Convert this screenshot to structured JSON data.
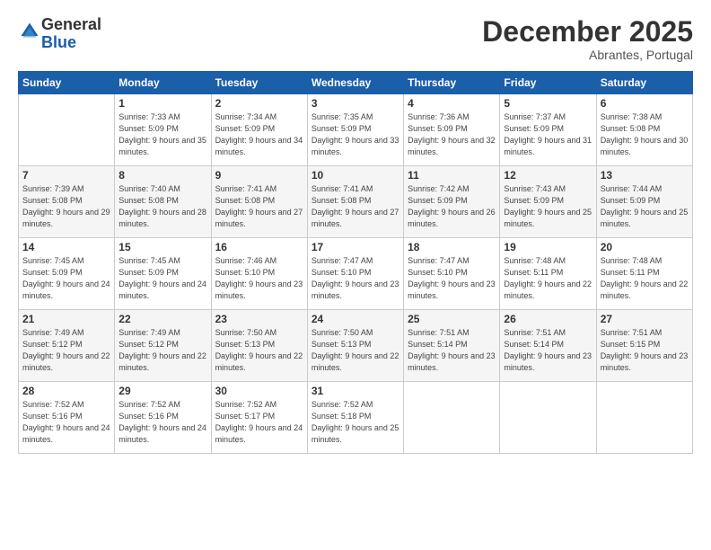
{
  "logo": {
    "general": "General",
    "blue": "Blue"
  },
  "header": {
    "month": "December 2025",
    "location": "Abrantes, Portugal"
  },
  "weekdays": [
    "Sunday",
    "Monday",
    "Tuesday",
    "Wednesday",
    "Thursday",
    "Friday",
    "Saturday"
  ],
  "weeks": [
    [
      {
        "day": "",
        "sunrise": "",
        "sunset": "",
        "daylight": ""
      },
      {
        "day": "1",
        "sunrise": "Sunrise: 7:33 AM",
        "sunset": "Sunset: 5:09 PM",
        "daylight": "Daylight: 9 hours and 35 minutes."
      },
      {
        "day": "2",
        "sunrise": "Sunrise: 7:34 AM",
        "sunset": "Sunset: 5:09 PM",
        "daylight": "Daylight: 9 hours and 34 minutes."
      },
      {
        "day": "3",
        "sunrise": "Sunrise: 7:35 AM",
        "sunset": "Sunset: 5:09 PM",
        "daylight": "Daylight: 9 hours and 33 minutes."
      },
      {
        "day": "4",
        "sunrise": "Sunrise: 7:36 AM",
        "sunset": "Sunset: 5:09 PM",
        "daylight": "Daylight: 9 hours and 32 minutes."
      },
      {
        "day": "5",
        "sunrise": "Sunrise: 7:37 AM",
        "sunset": "Sunset: 5:09 PM",
        "daylight": "Daylight: 9 hours and 31 minutes."
      },
      {
        "day": "6",
        "sunrise": "Sunrise: 7:38 AM",
        "sunset": "Sunset: 5:08 PM",
        "daylight": "Daylight: 9 hours and 30 minutes."
      }
    ],
    [
      {
        "day": "7",
        "sunrise": "Sunrise: 7:39 AM",
        "sunset": "Sunset: 5:08 PM",
        "daylight": "Daylight: 9 hours and 29 minutes."
      },
      {
        "day": "8",
        "sunrise": "Sunrise: 7:40 AM",
        "sunset": "Sunset: 5:08 PM",
        "daylight": "Daylight: 9 hours and 28 minutes."
      },
      {
        "day": "9",
        "sunrise": "Sunrise: 7:41 AM",
        "sunset": "Sunset: 5:08 PM",
        "daylight": "Daylight: 9 hours and 27 minutes."
      },
      {
        "day": "10",
        "sunrise": "Sunrise: 7:41 AM",
        "sunset": "Sunset: 5:08 PM",
        "daylight": "Daylight: 9 hours and 27 minutes."
      },
      {
        "day": "11",
        "sunrise": "Sunrise: 7:42 AM",
        "sunset": "Sunset: 5:09 PM",
        "daylight": "Daylight: 9 hours and 26 minutes."
      },
      {
        "day": "12",
        "sunrise": "Sunrise: 7:43 AM",
        "sunset": "Sunset: 5:09 PM",
        "daylight": "Daylight: 9 hours and 25 minutes."
      },
      {
        "day": "13",
        "sunrise": "Sunrise: 7:44 AM",
        "sunset": "Sunset: 5:09 PM",
        "daylight": "Daylight: 9 hours and 25 minutes."
      }
    ],
    [
      {
        "day": "14",
        "sunrise": "Sunrise: 7:45 AM",
        "sunset": "Sunset: 5:09 PM",
        "daylight": "Daylight: 9 hours and 24 minutes."
      },
      {
        "day": "15",
        "sunrise": "Sunrise: 7:45 AM",
        "sunset": "Sunset: 5:09 PM",
        "daylight": "Daylight: 9 hours and 24 minutes."
      },
      {
        "day": "16",
        "sunrise": "Sunrise: 7:46 AM",
        "sunset": "Sunset: 5:10 PM",
        "daylight": "Daylight: 9 hours and 23 minutes."
      },
      {
        "day": "17",
        "sunrise": "Sunrise: 7:47 AM",
        "sunset": "Sunset: 5:10 PM",
        "daylight": "Daylight: 9 hours and 23 minutes."
      },
      {
        "day": "18",
        "sunrise": "Sunrise: 7:47 AM",
        "sunset": "Sunset: 5:10 PM",
        "daylight": "Daylight: 9 hours and 23 minutes."
      },
      {
        "day": "19",
        "sunrise": "Sunrise: 7:48 AM",
        "sunset": "Sunset: 5:11 PM",
        "daylight": "Daylight: 9 hours and 22 minutes."
      },
      {
        "day": "20",
        "sunrise": "Sunrise: 7:48 AM",
        "sunset": "Sunset: 5:11 PM",
        "daylight": "Daylight: 9 hours and 22 minutes."
      }
    ],
    [
      {
        "day": "21",
        "sunrise": "Sunrise: 7:49 AM",
        "sunset": "Sunset: 5:12 PM",
        "daylight": "Daylight: 9 hours and 22 minutes."
      },
      {
        "day": "22",
        "sunrise": "Sunrise: 7:49 AM",
        "sunset": "Sunset: 5:12 PM",
        "daylight": "Daylight: 9 hours and 22 minutes."
      },
      {
        "day": "23",
        "sunrise": "Sunrise: 7:50 AM",
        "sunset": "Sunset: 5:13 PM",
        "daylight": "Daylight: 9 hours and 22 minutes."
      },
      {
        "day": "24",
        "sunrise": "Sunrise: 7:50 AM",
        "sunset": "Sunset: 5:13 PM",
        "daylight": "Daylight: 9 hours and 22 minutes."
      },
      {
        "day": "25",
        "sunrise": "Sunrise: 7:51 AM",
        "sunset": "Sunset: 5:14 PM",
        "daylight": "Daylight: 9 hours and 23 minutes."
      },
      {
        "day": "26",
        "sunrise": "Sunrise: 7:51 AM",
        "sunset": "Sunset: 5:14 PM",
        "daylight": "Daylight: 9 hours and 23 minutes."
      },
      {
        "day": "27",
        "sunrise": "Sunrise: 7:51 AM",
        "sunset": "Sunset: 5:15 PM",
        "daylight": "Daylight: 9 hours and 23 minutes."
      }
    ],
    [
      {
        "day": "28",
        "sunrise": "Sunrise: 7:52 AM",
        "sunset": "Sunset: 5:16 PM",
        "daylight": "Daylight: 9 hours and 24 minutes."
      },
      {
        "day": "29",
        "sunrise": "Sunrise: 7:52 AM",
        "sunset": "Sunset: 5:16 PM",
        "daylight": "Daylight: 9 hours and 24 minutes."
      },
      {
        "day": "30",
        "sunrise": "Sunrise: 7:52 AM",
        "sunset": "Sunset: 5:17 PM",
        "daylight": "Daylight: 9 hours and 24 minutes."
      },
      {
        "day": "31",
        "sunrise": "Sunrise: 7:52 AM",
        "sunset": "Sunset: 5:18 PM",
        "daylight": "Daylight: 9 hours and 25 minutes."
      },
      {
        "day": "",
        "sunrise": "",
        "sunset": "",
        "daylight": ""
      },
      {
        "day": "",
        "sunrise": "",
        "sunset": "",
        "daylight": ""
      },
      {
        "day": "",
        "sunrise": "",
        "sunset": "",
        "daylight": ""
      }
    ]
  ]
}
